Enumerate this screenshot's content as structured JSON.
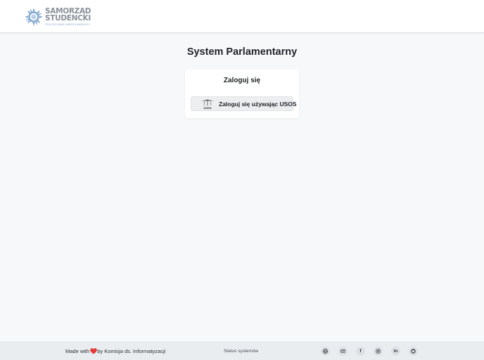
{
  "header": {
    "logo": {
      "line1": "SAMORZĄD",
      "line2": "STUDENCKI",
      "subtitle": "POLITECHNIKI WROCŁAWSKIEJ",
      "icon": "sun-gear-logo"
    }
  },
  "main": {
    "title": "System Parlamentarny",
    "login_card": {
      "title": "Zaloguj się",
      "usos_button_label": "Zaloguj się używając USOS",
      "usos_logo_text": "USOS"
    }
  },
  "footer": {
    "made_with": "Made with",
    "by_text": "by Komisja ds. Informatyzacji",
    "status_link": "Status systemów",
    "socials": [
      {
        "name": "website",
        "icon": "globe-icon"
      },
      {
        "name": "email",
        "icon": "mail-icon"
      },
      {
        "name": "facebook",
        "icon": "facebook-icon",
        "glyph": "f"
      },
      {
        "name": "instagram",
        "icon": "instagram-icon"
      },
      {
        "name": "linkedin",
        "icon": "linkedin-icon",
        "glyph": "in"
      },
      {
        "name": "github",
        "icon": "github-icon"
      }
    ]
  },
  "colors": {
    "background": "#f7f8fa",
    "heart": "#e53935",
    "logo_blue": "#7f9fc0",
    "logo_gray": "#8a9099"
  }
}
